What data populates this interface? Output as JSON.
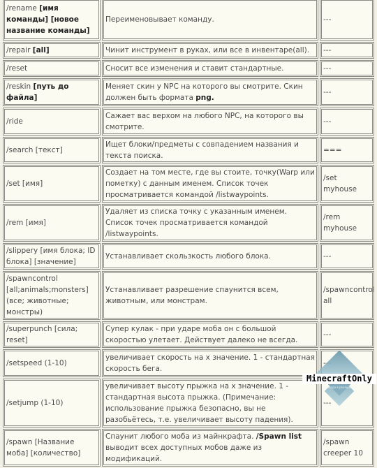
{
  "rows": [
    {
      "cmd": [
        {
          "t": "/rename "
        },
        {
          "t": "[имя команды] [новое название команды]",
          "b": true
        }
      ],
      "desc": [
        {
          "t": "Переименовывает команду."
        }
      ],
      "example": "---",
      "h": 56
    },
    {
      "cmd": [
        {
          "t": "/repair "
        },
        {
          "t": "[all]",
          "b": true
        }
      ],
      "desc": [
        {
          "t": "Чинит инструмент в руках, или все в инвентаре(all)."
        }
      ],
      "example": "---",
      "h": 20
    },
    {
      "cmd": [
        {
          "t": "/reset"
        }
      ],
      "desc": [
        {
          "t": "Сносит все изменения и ставит стандартные."
        }
      ],
      "example": "---",
      "h": 20
    },
    {
      "cmd": [
        {
          "t": "/reskin "
        },
        {
          "t": "[путь до файла]",
          "b": true
        }
      ],
      "desc": [
        {
          "t": "Меняет скин у NPC на которого вы смотрите. Скин должен быть формата "
        },
        {
          "t": "png.",
          "b": true
        }
      ],
      "example": "---",
      "h": 36
    },
    {
      "cmd": [
        {
          "t": "/ride"
        }
      ],
      "desc": [
        {
          "t": "Сажает вас верхом на любого NPC, на которого вы смотрите."
        }
      ],
      "example": "---",
      "h": 36
    },
    {
      "cmd": [
        {
          "t": "/search [текст]"
        }
      ],
      "desc": [
        {
          "t": "Ищет блоки/предметы с совпадением названия и текста поиска."
        }
      ],
      "example": "===",
      "h": 32
    },
    {
      "cmd": [
        {
          "t": "/set [имя]"
        }
      ],
      "desc": [
        {
          "t": "Создает на том месте, где вы стоите, точку(Warp или пометку) с данным именем. Список точек просматривается командой /listwaypoints."
        }
      ],
      "example": "/set myhouse",
      "h": 50
    },
    {
      "cmd": [
        {
          "t": "/rem [имя]"
        }
      ],
      "desc": [
        {
          "t": "Удаляет из списка точку с указанным именем. Список точек просматривается командой /listwaypoints."
        }
      ],
      "example": "/rem myhouse",
      "h": 34
    },
    {
      "cmd": [
        {
          "t": "/slippery [имя блока; ID блока] [значение]"
        }
      ],
      "desc": [
        {
          "t": "Устанавливает скользкость любого блока."
        }
      ],
      "example": "---",
      "h": 34
    },
    {
      "cmd": [
        {
          "t": "/spawncontrol [all;animals;monsters] (все; животные; монстры)"
        }
      ],
      "desc": [
        {
          "t": "Устанавливает разрешение спаунится всем, животным, или монстрам."
        }
      ],
      "example": "/spawncontrol all",
      "h": 50
    },
    {
      "cmd": [
        {
          "t": "/superpunch [сила; reset]"
        }
      ],
      "desc": [
        {
          "t": "Супер кулак - при ударе моба он с большой скоростью улетает. Действует далеко не всегда."
        }
      ],
      "example": "---",
      "h": 34
    },
    {
      "cmd": [
        {
          "t": "/setspeed (1-10)"
        }
      ],
      "desc": [
        {
          "t": "увеличивает скорость на х значение. 1 - стандартная скорость бега."
        }
      ],
      "example": "---",
      "h": 36
    },
    {
      "cmd": [
        {
          "t": "/setjump (1-10)"
        }
      ],
      "desc": [
        {
          "t": "увеличивает высоту прыжка на х значение. 1 - стандартная высота прыжка. (Примечание: использование прыжка безопасно, вы не разобьётесь, т.е. увеличивает высоту падения)."
        }
      ],
      "example": "---",
      "h": 66
    },
    {
      "cmd": [
        {
          "t": "/spawn [Название моба] [количество]"
        }
      ],
      "desc": [
        {
          "t": "Спаунит любого моба из майнкрафта. "
        },
        {
          "t": "/Spawn list",
          "b": true
        },
        {
          "t": " выводит всех доступных мобов даже из модификаций."
        }
      ],
      "example": "/spawn creeper 10",
      "h": 36
    }
  ],
  "watermark": {
    "brand": "MinecraftOnly",
    "tagline": "Свобода в реальности"
  },
  "colors": {
    "cell_bg": "#fbfbf2",
    "border": "#8c8c86",
    "text": "#4a4a4a"
  }
}
